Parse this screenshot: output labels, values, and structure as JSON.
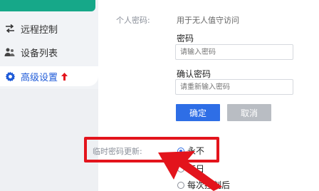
{
  "sidebar": {
    "items": [
      {
        "label": "远程控制",
        "icon": "swap-arrows-icon"
      },
      {
        "label": "设备列表",
        "icon": "users-icon"
      },
      {
        "label": "高级设置",
        "icon": "gear-icon",
        "active": true
      }
    ]
  },
  "settings": {
    "personal_password_label": "个人密码:",
    "personal_password_desc": "用于无人值守访问",
    "password_label": "密码",
    "password_placeholder": "请输入密码",
    "confirm_label": "确认密码",
    "confirm_placeholder": "请重新输入密码",
    "confirm_button": "确定",
    "cancel_button": "取消",
    "temp_update_label": "临时密码更新:",
    "options": [
      "永不",
      "每日",
      "每次控制后"
    ],
    "selected_option": "永不"
  },
  "colors": {
    "accent": "#2e6ee6",
    "annotation": "#e3141c",
    "sidebar_top": "#16a889"
  }
}
